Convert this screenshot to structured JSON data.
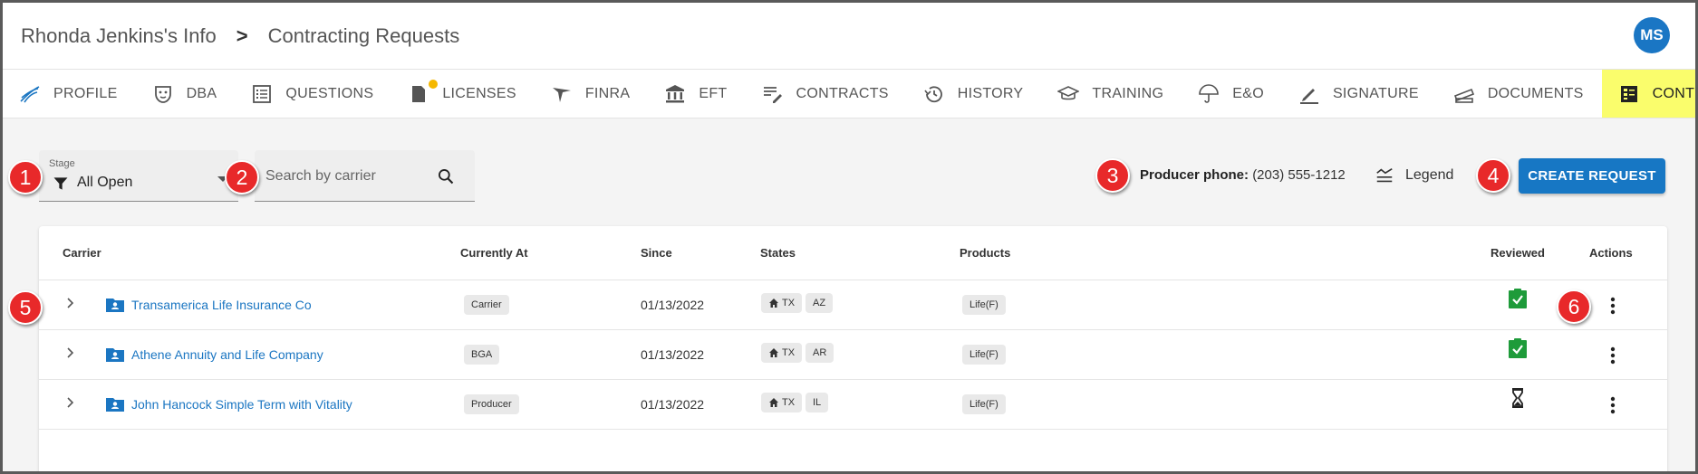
{
  "breadcrumb": {
    "parent": "Rhonda Jenkins's Info",
    "separator": ">",
    "current": "Contracting Requests"
  },
  "user": {
    "initials": "MS",
    "avatar_color": "#1a76c4"
  },
  "tabs": [
    {
      "label": "PROFILE",
      "icon": "profile-icon"
    },
    {
      "label": "DBA",
      "icon": "mask-icon"
    },
    {
      "label": "QUESTIONS",
      "icon": "list-icon"
    },
    {
      "label": "LICENSES",
      "icon": "license-icon",
      "badge": true
    },
    {
      "label": "FINRA",
      "icon": "finra-icon"
    },
    {
      "label": "EFT",
      "icon": "bank-icon"
    },
    {
      "label": "CONTRACTS",
      "icon": "edit-note-icon"
    },
    {
      "label": "HISTORY",
      "icon": "history-icon"
    },
    {
      "label": "TRAINING",
      "icon": "school-icon"
    },
    {
      "label": "E&O",
      "icon": "umbrella-icon"
    },
    {
      "label": "SIGNATURE",
      "icon": "pen-icon"
    },
    {
      "label": "DOCUMENTS",
      "icon": "documents-icon"
    },
    {
      "label": "CONTRACTING REQUESTS",
      "icon": "dashboard-icon",
      "active": true
    }
  ],
  "filters": {
    "stage_label": "Stage",
    "stage_value": "All Open",
    "search_placeholder": "Search by carrier"
  },
  "producer": {
    "label": "Producer phone:",
    "phone": "(203) 555-1212"
  },
  "legend_label": "Legend",
  "create_button": "CREATE REQUEST",
  "table": {
    "headers": {
      "carrier": "Carrier",
      "currently_at": "Currently At",
      "since": "Since",
      "states": "States",
      "products": "Products",
      "reviewed": "Reviewed",
      "actions": "Actions"
    },
    "rows": [
      {
        "carrier": "Transamerica Life Insurance Co",
        "currently_at": "Carrier",
        "since": "01/13/2022",
        "home_state": "TX",
        "state": "AZ",
        "product": "Life(F)",
        "reviewed": "check"
      },
      {
        "carrier": "Athene Annuity and Life Company",
        "currently_at": "BGA",
        "since": "01/13/2022",
        "home_state": "TX",
        "state": "AR",
        "product": "Life(F)",
        "reviewed": "check"
      },
      {
        "carrier": "John Hancock Simple Term with Vitality",
        "currently_at": "Producer",
        "since": "01/13/2022",
        "home_state": "TX",
        "state": "IL",
        "product": "Life(F)",
        "reviewed": "pending"
      }
    ]
  },
  "callouts": [
    "1",
    "2",
    "3",
    "4",
    "5",
    "6"
  ],
  "colors": {
    "accent": "#1777c4",
    "active_tab": "#fafd6c",
    "callout": "#e8292a",
    "reviewed_ok": "#1e9b3a",
    "license_badge": "#f5b800"
  }
}
